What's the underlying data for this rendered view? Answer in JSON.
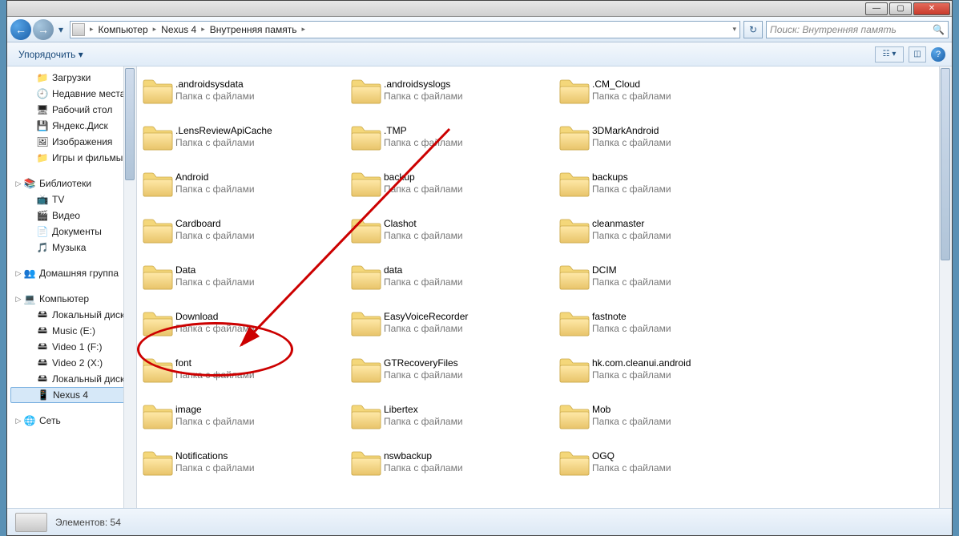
{
  "titlebar": {},
  "nav": {
    "breadcrumbs": [
      "Компьютер",
      "Nexus 4",
      "Внутренняя память"
    ],
    "search_placeholder": "Поиск: Внутренняя память"
  },
  "toolbar": {
    "organize": "Упорядочить"
  },
  "sidebar": {
    "g1": [
      {
        "label": "Загрузки",
        "icon": "folder"
      },
      {
        "label": "Недавние места",
        "icon": "recent"
      },
      {
        "label": "Рабочий стол",
        "icon": "desktop"
      },
      {
        "label": "Яндекс.Диск",
        "icon": "yadisk"
      },
      {
        "label": "Изображения",
        "icon": "pictures"
      },
      {
        "label": "Игры и фильмы",
        "icon": "folder"
      }
    ],
    "g2_title": "Библиотеки",
    "g2": [
      {
        "label": "TV",
        "icon": "tv"
      },
      {
        "label": "Видео",
        "icon": "video"
      },
      {
        "label": "Документы",
        "icon": "docs"
      },
      {
        "label": "Музыка",
        "icon": "music"
      }
    ],
    "g3_title": "Домашняя группа",
    "g4_title": "Компьютер",
    "g4": [
      {
        "label": "Локальный диск",
        "icon": "hdd"
      },
      {
        "label": "Music (E:)",
        "icon": "hdd"
      },
      {
        "label": "Video 1 (F:)",
        "icon": "hdd"
      },
      {
        "label": "Video 2 (X:)",
        "icon": "hdd"
      },
      {
        "label": "Локальный диск",
        "icon": "hdd"
      },
      {
        "label": "Nexus 4",
        "icon": "phone",
        "selected": true
      }
    ],
    "g5_title": "Сеть"
  },
  "folders": {
    "type_label": "Папка с файлами",
    "items": [
      ".androidsysdata",
      ".androidsyslogs",
      ".CM_Cloud",
      ".LensReviewApiCache",
      ".TMP",
      "3DMarkAndroid",
      "Android",
      "backup",
      "backups",
      "Cardboard",
      "Clashot",
      "cleanmaster",
      "Data",
      "data",
      "DCIM",
      "Download",
      "EasyVoiceRecorder",
      "fastnote",
      "font",
      "GTRecoveryFiles",
      "hk.com.cleanui.android",
      "image",
      "Libertex",
      "Mob",
      "Notifications",
      "nswbackup",
      "OGQ"
    ]
  },
  "status": {
    "elements_label": "Элементов:",
    "count": "54"
  }
}
